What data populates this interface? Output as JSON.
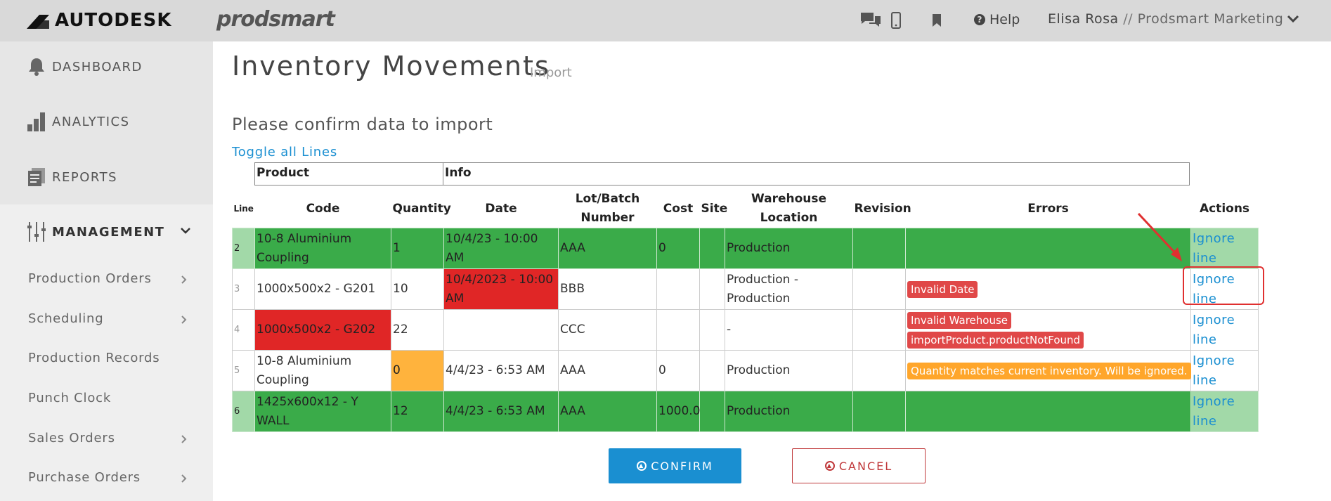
{
  "header": {
    "autodesk_brand": "AUTODESK",
    "product_brand": "prodsmart",
    "help_label": "Help",
    "user_name": "Elisa Rosa",
    "user_separator": " // ",
    "company": "Prodsmart Marketing",
    "icons": [
      "chat-icon",
      "mobile-icon",
      "bookmark-icon",
      "help-icon",
      "chevron-down-icon"
    ]
  },
  "sidebar": {
    "main_items": [
      {
        "label": "DASHBOARD",
        "icon": "bell-icon"
      },
      {
        "label": "ANALYTICS",
        "icon": "bar-chart-icon"
      },
      {
        "label": "REPORTS",
        "icon": "document-icon"
      },
      {
        "label": "MANAGEMENT",
        "icon": "sliders-icon"
      }
    ],
    "sub_items": [
      {
        "label": "Production Orders",
        "chevron": true
      },
      {
        "label": "Scheduling",
        "chevron": true
      },
      {
        "label": "Production Records",
        "chevron": false
      },
      {
        "label": "Punch Clock",
        "chevron": false
      },
      {
        "label": "Sales Orders",
        "chevron": true
      },
      {
        "label": "Purchase Orders",
        "chevron": true
      }
    ]
  },
  "page": {
    "title": "Inventory Movements",
    "subtitle": "Import",
    "confirm_message": "Please confirm data to import",
    "toggle_label": "Toggle all Lines",
    "group_headers": {
      "product": "Product",
      "info": "Info"
    }
  },
  "table": {
    "headers": [
      "Line",
      "Code",
      "Quantity",
      "Date",
      "Lot/Batch Number",
      "Cost",
      "Site",
      "Warehouse Location",
      "Revision",
      "Errors",
      "Actions"
    ],
    "rows": [
      {
        "line": "2",
        "code": "10-8 Aluminium Coupling",
        "quantity": "1",
        "date": "10/4/23 - 10:00 AM",
        "lot": "AAA",
        "cost": "0",
        "site": "",
        "warehouse": "Production",
        "revision": "",
        "errors": [],
        "action": "Ignore line"
      },
      {
        "line": "3",
        "code": "1000x500x2 - G201",
        "quantity": "10",
        "date": "10/4/2023 - 10:00 AM",
        "lot": "BBB",
        "cost": "",
        "site": "",
        "warehouse": "Production - Production",
        "revision": "",
        "errors": [
          "Invalid Date"
        ],
        "action": "Ignore line"
      },
      {
        "line": "4",
        "code": "1000x500x2 - G202",
        "quantity": "22",
        "date": "",
        "lot": "CCC",
        "cost": "",
        "site": "",
        "warehouse": "-",
        "revision": "",
        "errors": [
          "Invalid Warehouse",
          "importProduct.productNotFound"
        ],
        "action": "Ignore line"
      },
      {
        "line": "5",
        "code": "10-8 Aluminium Coupling",
        "quantity": "0",
        "date": "4/4/23 - 6:53 AM",
        "lot": "AAA",
        "cost": "0",
        "site": "",
        "warehouse": "Production",
        "revision": "",
        "errors": [
          "Quantity matches current inventory. Will be ignored."
        ],
        "action": "Ignore line"
      },
      {
        "line": "6",
        "code": "1425x600x12 - Y WALL",
        "quantity": "12",
        "date": "4/4/23 - 6:53 AM",
        "lot": "AAA",
        "cost": "1000.0",
        "site": "",
        "warehouse": "Production",
        "revision": "",
        "errors": [],
        "action": "Ignore line"
      }
    ]
  },
  "buttons": {
    "confirm": "CONFIRM",
    "cancel": "CANCEL"
  },
  "colors": {
    "ok_row": "#3aab49",
    "error_cell": "#e02626",
    "warning_cell": "#ffb33d",
    "accent_blue": "#1a8fd1",
    "cancel_red": "#c0393b"
  }
}
